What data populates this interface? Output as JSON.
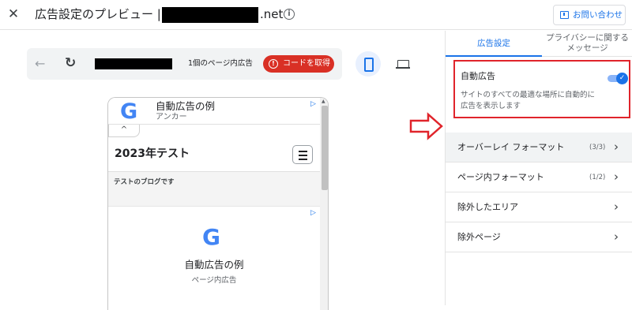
{
  "header": {
    "title": "広告設定のプレビュー | ",
    "domain_suffix": ".net",
    "info_icon": "i",
    "contact_label": "お問い合わせ"
  },
  "toolbar": {
    "ad_count": "1個のページ内広告",
    "get_code_label": "コードを取得"
  },
  "preview": {
    "anchor_ad": {
      "title": "自動広告の例",
      "subtitle": "アンカー"
    },
    "collapse_glyph": "^",
    "site_title": "2023年テスト",
    "blog_text": "テストのブログです",
    "inpage_ad": {
      "title": "自動広告の例",
      "subtitle": "ページ内広告"
    },
    "adchoices_glyph": "▷"
  },
  "settings": {
    "tabs": [
      "広告設定",
      "プライバシーに関するメッセージ"
    ],
    "auto_ads": {
      "label": "自動広告",
      "description": "サイトのすべての最適な場所に自動的に広告を表示します",
      "enabled": true
    },
    "items": [
      {
        "label": "オーバーレイ フォーマット",
        "count": "(3/3)"
      },
      {
        "label": "ページ内フォーマット",
        "count": "(1/2)"
      },
      {
        "label": "除外したエリア",
        "count": ""
      },
      {
        "label": "除外ページ",
        "count": ""
      }
    ]
  },
  "colors": {
    "accent": "#1a73e8",
    "danger": "#d93025",
    "highlight": "#e0242b"
  }
}
